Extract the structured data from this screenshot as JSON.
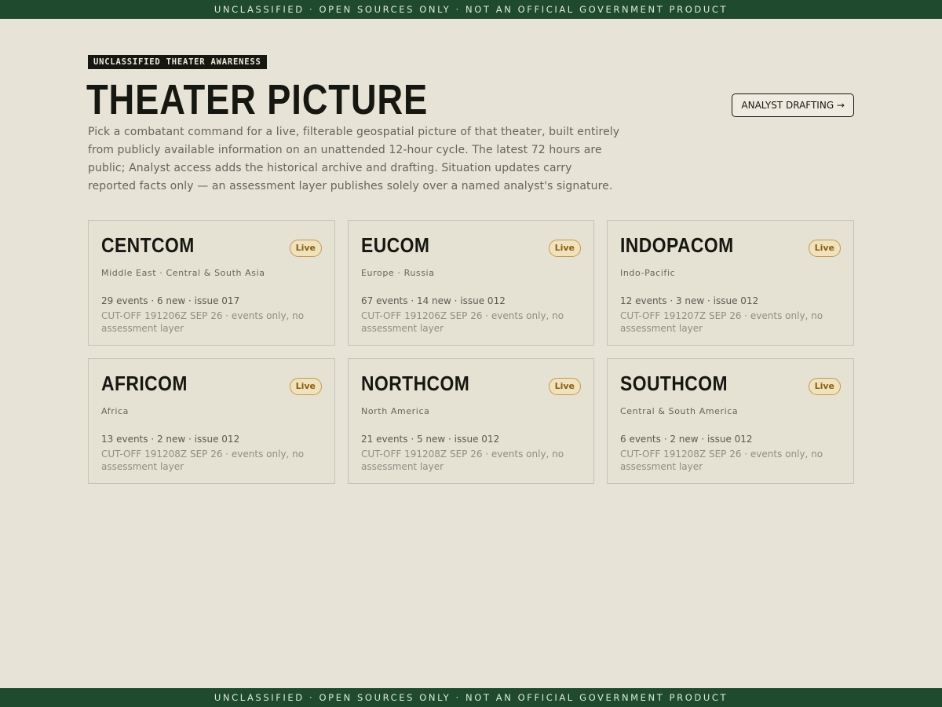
{
  "banner": "UNCLASSIFIED · OPEN SOURCES ONLY · NOT AN OFFICIAL GOVERNMENT PRODUCT",
  "header": {
    "kicker": "UNCLASSIFIED THEATER AWARENESS",
    "title": "THEATER PICTURE",
    "drafting_button": "ANALYST DRAFTING →",
    "intro": "Pick a combatant command for a live, filterable geospatial picture of that theater, built entirely from publicly available information on an unattended 12-hour cycle. The latest 72 hours are public; Analyst access adds the historical archive and drafting. Situation updates carry reported facts only — an assessment layer publishes solely over a named analyst's signature."
  },
  "commands": [
    {
      "name": "CENTCOM",
      "status": "Live",
      "region": "Middle East · Central & South Asia",
      "stats": "29 events · 6 new · issue 017",
      "cutoff": "CUT-OFF 191206Z SEP 26 · events only, no assessment layer"
    },
    {
      "name": "EUCOM",
      "status": "Live",
      "region": "Europe · Russia",
      "stats": "67 events · 14 new · issue 012",
      "cutoff": "CUT-OFF 191206Z SEP 26 · events only, no assessment layer"
    },
    {
      "name": "INDOPACOM",
      "status": "Live",
      "region": "Indo-Pacific",
      "stats": "12 events · 3 new · issue 012",
      "cutoff": "CUT-OFF 191207Z SEP 26 · events only, no assessment layer"
    },
    {
      "name": "AFRICOM",
      "status": "Live",
      "region": "Africa",
      "stats": "13 events · 2 new · issue 012",
      "cutoff": "CUT-OFF 191208Z SEP 26 · events only, no assessment layer"
    },
    {
      "name": "NORTHCOM",
      "status": "Live",
      "region": "North America",
      "stats": "21 events · 5 new · issue 012",
      "cutoff": "CUT-OFF 191208Z SEP 26 · events only, no assessment layer"
    },
    {
      "name": "SOUTHCOM",
      "status": "Live",
      "region": "Central & South America",
      "stats": "6 events · 2 new · issue 012",
      "cutoff": "CUT-OFF 191208Z SEP 26 · events only, no assessment layer"
    }
  ],
  "colors": {
    "background": "#e7e3d6",
    "banner": "#1f4a2d",
    "ink": "#171712",
    "live_badge_border": "#c49a52",
    "live_badge_fill": "#f0e2bd"
  }
}
